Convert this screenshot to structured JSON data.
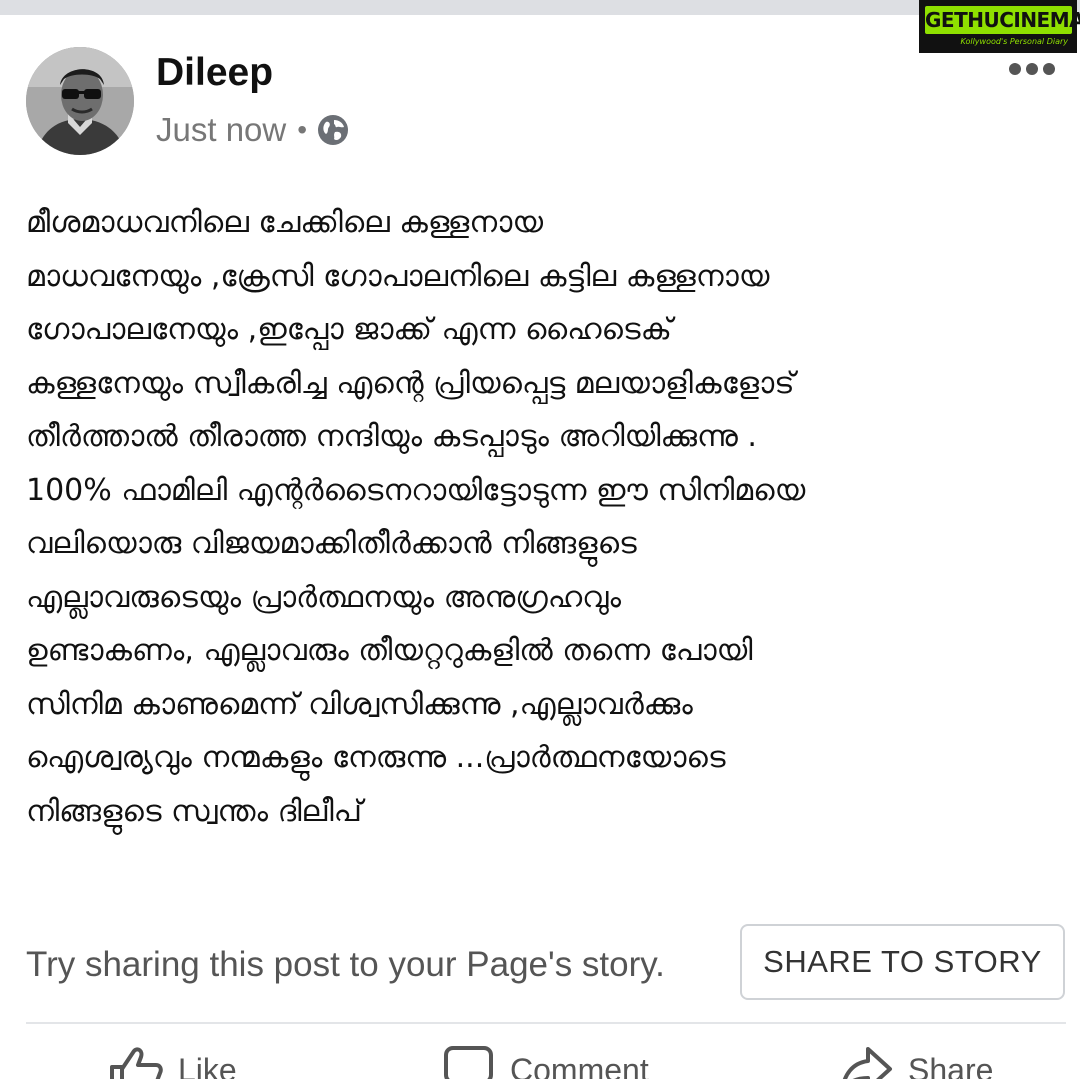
{
  "watermark": {
    "logo": "GETHUCINEMA",
    "tagline": "Kollywood's Personal Diary"
  },
  "post": {
    "author": "Dileep",
    "timestamp": "Just now",
    "separator": "•",
    "lines": [
      "മീശമാധവനിലെ ചേക്കിലെ കള്ളനായ",
      "മാധവനേയും ,ക്രേസി ഗോപാലനിലെ കട്ടില കള്ളനായ",
      "ഗോപാലനേയും ,ഇപ്പോ ജാക്ക് എന്ന ഹൈടെക്",
      "കള്ളനേയും സ്വീകരിച്ച എന്റെ പ്രിയപ്പെട്ട മലയാളികളോട്",
      "തീർത്താൽ തീരാത്ത നന്ദിയും കടപ്പാടും അറിയിക്കുന്നു .",
      "100% ഫാമിലി എന്റർടൈനറായിട്ടോടുന്ന ഈ സിനിമയെ",
      "വലിയൊരു വിജയമാക്കിതീർക്കാൻ നിങ്ങളുടെ",
      "എല്ലാവരുടെയും പ്രാർത്ഥനയും അനുഗ്രഹവും",
      "ഉണ്ടാകണം,  എല്ലാവരും തീയറ്ററുകളിൽ തന്നെ പോയി",
      "സിനിമ  കാണുമെന്ന്  വിശ്വസിക്കുന്നു ,എല്ലാവർക്കും",
      "ഐശ്വര്യവും നന്മകളും  നേരുന്നു ...പ്രാർത്ഥനയോടെ",
      "നിങ്ങളുടെ സ്വന്തം ദിലീപ്"
    ]
  },
  "share": {
    "prompt": "Try sharing this post to your Page's story.",
    "button_label": "SHARE TO STORY"
  },
  "actions": {
    "like": "Like",
    "comment": "Comment",
    "share": "Share"
  },
  "colors": {
    "accent_watermark": "#8fe000",
    "text_primary": "#111111",
    "text_secondary": "#777777"
  }
}
